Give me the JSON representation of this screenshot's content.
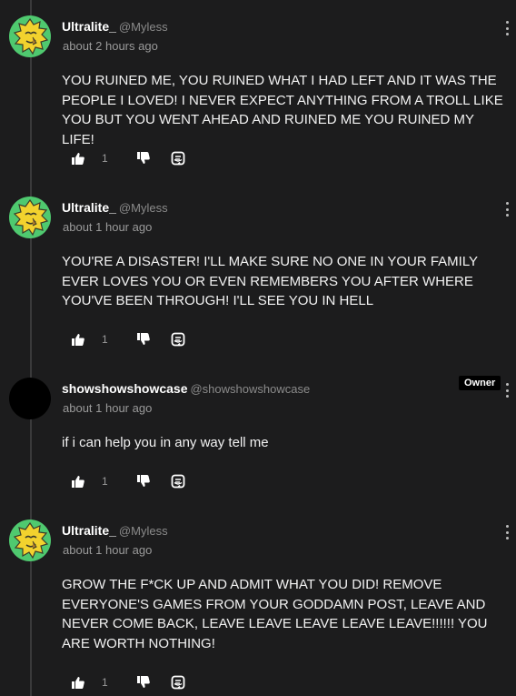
{
  "comments": [
    {
      "author": "Ultralite_",
      "handle": "@Myless",
      "time": "about 2 hours ago",
      "text": "YOU RUINED ME, YOU RUINED WHAT I HAD LEFT AND IT WAS THE PEOPLE I LOVED! I NEVER EXPECT ANYTHING FROM A TROLL LIKE YOU BUT YOU WENT AHEAD AND RUINED ME YOU RUINED MY LIFE!",
      "likes": "1",
      "avatar": "sun-face-avatar"
    },
    {
      "author": "Ultralite_",
      "handle": "@Myless",
      "time": "about 1 hour ago",
      "text": "YOU'RE A DISASTER! I'LL MAKE SURE NO ONE IN YOUR FAMILY EVER LOVES YOU OR EVEN REMEMBERS YOU AFTER WHERE YOU'VE BEEN THROUGH! I'LL SEE YOU IN HELL",
      "likes": "1",
      "avatar": "sun-face-avatar"
    },
    {
      "author": "showshowshowcase",
      "handle": "@showshowshowcase",
      "time": "about 1 hour ago",
      "text": "if i can help you in any way tell me",
      "likes": "1",
      "badge": "Owner",
      "avatar": "black-circle-avatar"
    },
    {
      "author": "Ultralite_",
      "handle": "@Myless",
      "time": "about 1 hour ago",
      "text": "GROW THE F*CK UP AND ADMIT WHAT YOU DID! REMOVE EVERYONE'S GAMES FROM YOUR GODDAMN POST, LEAVE AND NEVER COME BACK, LEAVE LEAVE LEAVE LEAVE LEAVE!!!!!! YOU ARE WORTH NOTHING!",
      "likes": "1",
      "avatar": "sun-face-avatar"
    }
  ],
  "colors": {
    "background": "#1c1c1d",
    "avatar_green": "#4fc96f",
    "sun_yellow": "#f2d22e"
  }
}
